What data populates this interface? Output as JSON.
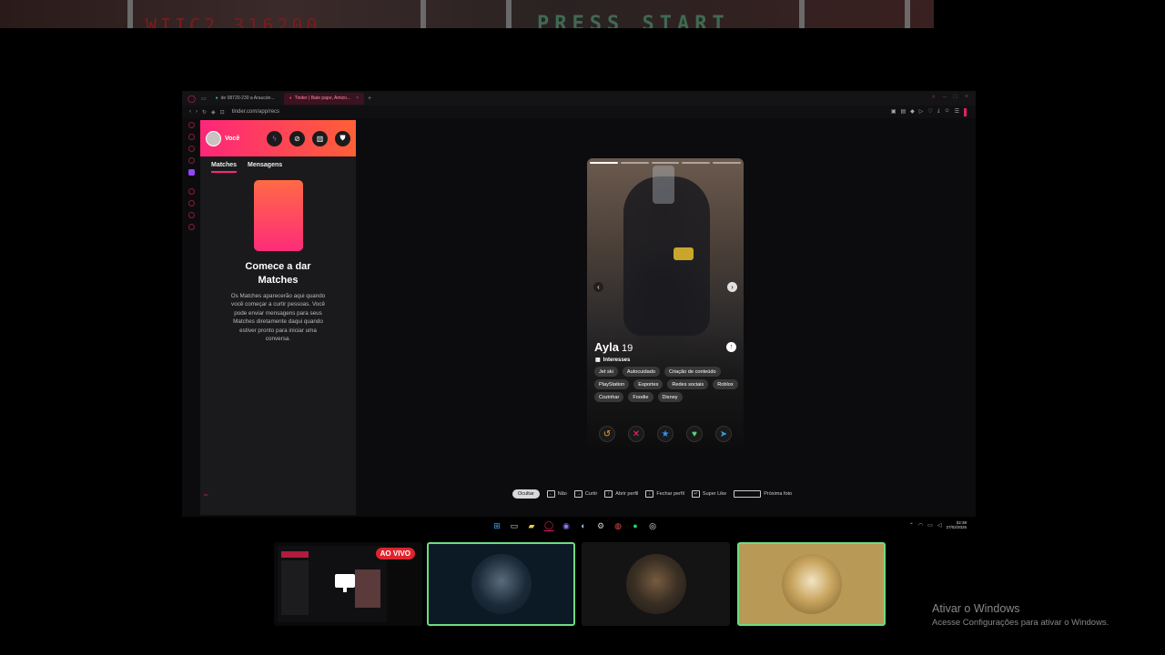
{
  "top_strip": {
    "score_text": "WIIC2 316200",
    "press_text": "PRESS START"
  },
  "browser": {
    "tabs": [
      {
        "label": "de 08720-230 a Araucán...",
        "active": false
      },
      {
        "label": "Tinder | Bate papo, Amizo...",
        "active": true
      }
    ],
    "new_tab": "+",
    "url": "tinder.com/app/recs"
  },
  "sidebar": {
    "user_label": "Você",
    "header_icons": [
      "bolt-icon",
      "explore-icon",
      "briefcase-icon",
      "shield-icon"
    ],
    "tabs": [
      {
        "label": "Matches",
        "active": true
      },
      {
        "label": "Mensagens",
        "active": false
      }
    ],
    "title": "Comece a dar Matches",
    "description": "Os Matches aparecerão aqui quando você começar a curtir pessoas. Você pode enviar mensagens para seus Matches diretamente daqui quando estiver pronto para iniciar uma conversa."
  },
  "profile": {
    "name": "Ayla",
    "age": "19",
    "interests_label": "Interesses",
    "interests": [
      "Jet ski",
      "Autocuidado",
      "Criação de conteúdo",
      "PlayStation",
      "Esportes",
      "Redes sociais",
      "Roblox",
      "Cozinhar",
      "Foodie",
      "Disney"
    ],
    "photo_count": 5,
    "current_photo": 1,
    "actions": [
      "rewind-icon",
      "nope-icon",
      "super-like-icon",
      "like-icon",
      "boost-icon"
    ]
  },
  "hints": {
    "hide_label": "Ocultar",
    "items": [
      {
        "key": "←",
        "label": "Não"
      },
      {
        "key": "→",
        "label": "Curtir"
      },
      {
        "key": "↑",
        "label": "Abrir perfil"
      },
      {
        "key": "↓",
        "label": "Fechar perfil"
      },
      {
        "key": "↵",
        "label": "Super Like"
      },
      {
        "key": "",
        "label": "Próxima foto"
      }
    ]
  },
  "taskbar": {
    "time": "02:38",
    "date": "27/02/2026"
  },
  "stream": {
    "live_label": "AO VIVO"
  },
  "watermark": {
    "title": "Ativar o Windows",
    "subtitle": "Acesse Configurações para ativar o Windows."
  },
  "colors": {
    "brand_gradient_start": "#fd267a",
    "brand_gradient_end": "#ff6036",
    "tile_border": "#6fdc7f",
    "live_red": "#e0242e"
  }
}
